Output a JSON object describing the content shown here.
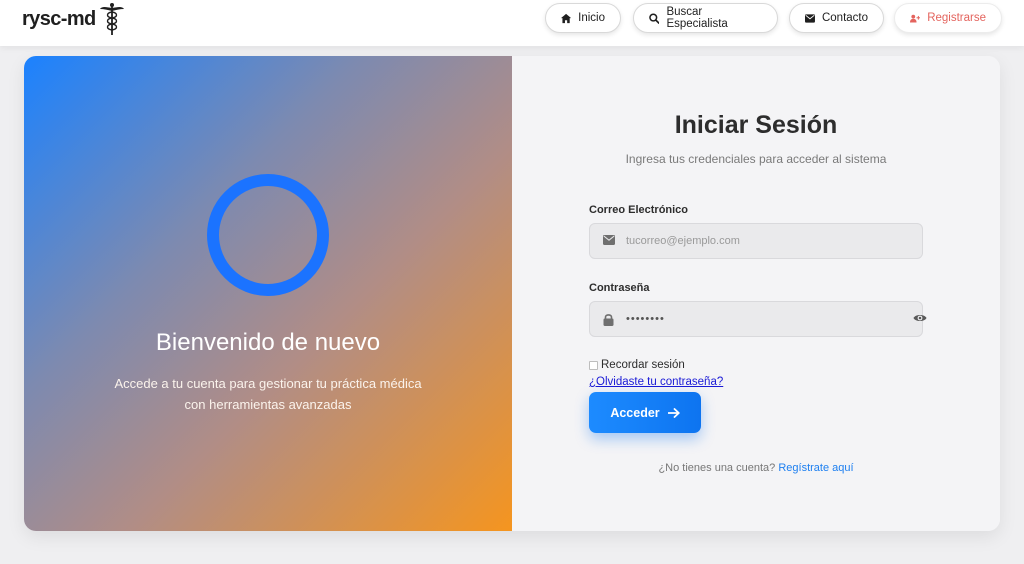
{
  "nav": {
    "logo_text": "rysc-md",
    "items": [
      {
        "label": "Inicio",
        "icon": "home-icon"
      },
      {
        "label": "Buscar Especialista",
        "icon": "search-icon"
      },
      {
        "label": "Contacto",
        "icon": "envelope-icon"
      },
      {
        "label": "Registrarse",
        "icon": "user-plus-icon"
      }
    ]
  },
  "welcome": {
    "title": "Bienvenido de nuevo",
    "text_line1": "Accede a tu cuenta para gestionar tu práctica médica",
    "text_line2": "con herramientas avanzadas"
  },
  "login": {
    "title": "Iniciar Sesión",
    "subtitle": "Ingresa tus credenciales para acceder al sistema",
    "email_label": "Correo Electrónico",
    "email_placeholder": "tucorreo@ejemplo.com",
    "password_label": "Contraseña",
    "password_value": "••••••••",
    "remember_label": "Recordar sesión",
    "forgot_label": "¿Olvidaste tu contraseña?",
    "submit_label": "Acceder",
    "register_prompt": "¿No tienes una cuenta?",
    "register_link": "Regístrate aquí"
  },
  "colors": {
    "accent": "#1d7ff0",
    "register_nav": "#e4645e",
    "gradient_start": "#1b82ff",
    "gradient_end": "#f5951f",
    "ring": "#1b73ff"
  }
}
